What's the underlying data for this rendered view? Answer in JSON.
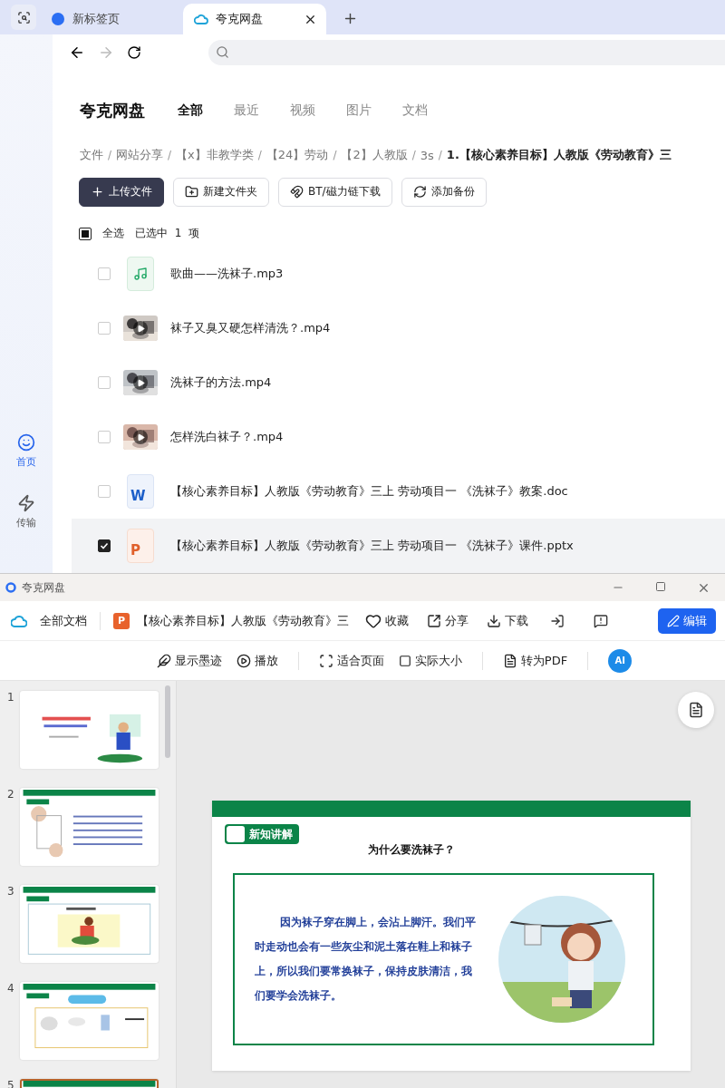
{
  "browser": {
    "tabs": [
      {
        "title": "新标签页",
        "selected": false
      },
      {
        "title": "夸克网盘",
        "selected": true
      }
    ]
  },
  "app": {
    "brand": "夸克网盘",
    "sidebar": [
      {
        "label": "首页",
        "kind": "home",
        "selected": true
      },
      {
        "label": "传输",
        "kind": "transfer",
        "selected": false
      }
    ],
    "categories": [
      {
        "label": "全部",
        "selected": true
      },
      {
        "label": "最近",
        "selected": false
      },
      {
        "label": "视频",
        "selected": false
      },
      {
        "label": "图片",
        "selected": false
      },
      {
        "label": "文档",
        "selected": false
      }
    ],
    "breadcrumb_separator": "/",
    "breadcrumb": [
      "文件",
      "网站分享",
      "【x】非教学类",
      "【24】劳动",
      "【2】人教版",
      "3s",
      "1.【核心素养目标】人教版《劳动教育》三"
    ],
    "actions": [
      {
        "label": "上传文件",
        "kind": "upload"
      },
      {
        "label": "新建文件夹",
        "kind": "folder"
      },
      {
        "label": "BT/磁力链下载",
        "kind": "magnet"
      },
      {
        "label": "添加备份",
        "kind": "backup"
      }
    ],
    "select_all": {
      "label": "全选",
      "summary": "已选中  1  项",
      "indeterminate": true
    },
    "files": [
      {
        "name": "歌曲——洗袜子.mp3",
        "kind": "audio",
        "checked": false,
        "selected": false
      },
      {
        "name": "袜子又臭又硬怎样清洗？.mp4",
        "kind": "video",
        "checked": false,
        "selected": false
      },
      {
        "name": "洗袜子的方法.mp4",
        "kind": "video",
        "checked": false,
        "selected": false
      },
      {
        "name": "怎样洗白袜子？.mp4",
        "kind": "video",
        "checked": false,
        "selected": false
      },
      {
        "name": "【核心素养目标】人教版《劳动教育》三上 劳动项目一 《洗袜子》教案.doc",
        "kind": "doc",
        "icon_letter": "W",
        "checked": false,
        "selected": false
      },
      {
        "name": "【核心素养目标】人教版《劳动教育》三上 劳动项目一 《洗袜子》课件.pptx",
        "kind": "ppt",
        "icon_letter": "P",
        "checked": true,
        "selected": true
      }
    ]
  },
  "viewer": {
    "window_title": "夸克网盘",
    "home": "全部文档",
    "doc_icon_letter": "P",
    "doc_title": "【核心素养目标】人教版《劳动教育》三",
    "actions": [
      {
        "label": "收藏",
        "kind": "favorite"
      },
      {
        "label": "分享",
        "kind": "share"
      },
      {
        "label": "下载",
        "kind": "download"
      }
    ],
    "edit": "编辑",
    "tools": [
      {
        "label": "显示墨迹",
        "kind": "ink"
      },
      {
        "label": "播放",
        "kind": "play"
      },
      {
        "label": "适合页面",
        "kind": "fit"
      },
      {
        "label": "实际大小",
        "kind": "actual"
      },
      {
        "label": "转为PDF",
        "kind": "pdf"
      }
    ],
    "ai_button": "AI",
    "slides": [
      {
        "number": "1",
        "kind": "cover",
        "selected": false
      },
      {
        "number": "2",
        "kind": "goals",
        "selected": false
      },
      {
        "number": "3",
        "kind": "intro",
        "selected": false
      },
      {
        "number": "4",
        "kind": "tools",
        "selected": false
      },
      {
        "number": "5",
        "kind": "content",
        "selected": true
      }
    ],
    "slide": {
      "tag": "新知讲解",
      "heading": "为什么要洗袜子？",
      "body": "因为袜子穿在脚上，会沾上脚汗。我们平时走动也会有一些灰尘和泥土落在鞋上和袜子上，所以我们要常换袜子，保持皮肤清洁，我们要学会洗袜子。"
    }
  }
}
